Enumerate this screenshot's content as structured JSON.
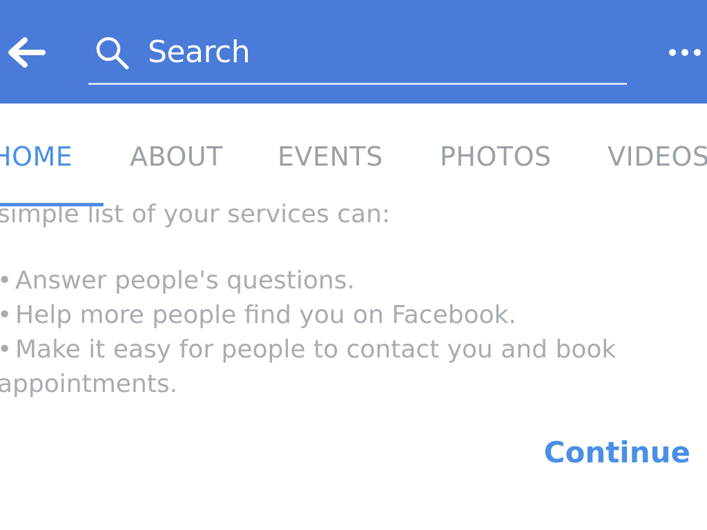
{
  "header": {
    "back_icon": "arrow-left-icon",
    "search": {
      "icon": "search-icon",
      "placeholder": "Search"
    },
    "more_icon": "more-dots-icon",
    "bg_color": "#4a7bd8"
  },
  "tabs": [
    {
      "label": "HOME",
      "active": true
    },
    {
      "label": "ABOUT",
      "active": false
    },
    {
      "label": "EVENTS",
      "active": false
    },
    {
      "label": "PHOTOS",
      "active": false
    },
    {
      "label": "VIDEOS",
      "active": false
    }
  ],
  "content": {
    "intro": "simple list of your services can:",
    "bullets": [
      "Answer people's questions.",
      "Help more people find you on Facebook.",
      "Make it easy for people to contact you and book"
    ],
    "bullet_continuation": "appointments.",
    "bullet_marker": "•"
  },
  "actions": {
    "continue_label": "Continue"
  },
  "colors": {
    "accent": "#4a8ee6",
    "muted_text": "#a8acb2",
    "tab_inactive": "#9aa0a8"
  }
}
